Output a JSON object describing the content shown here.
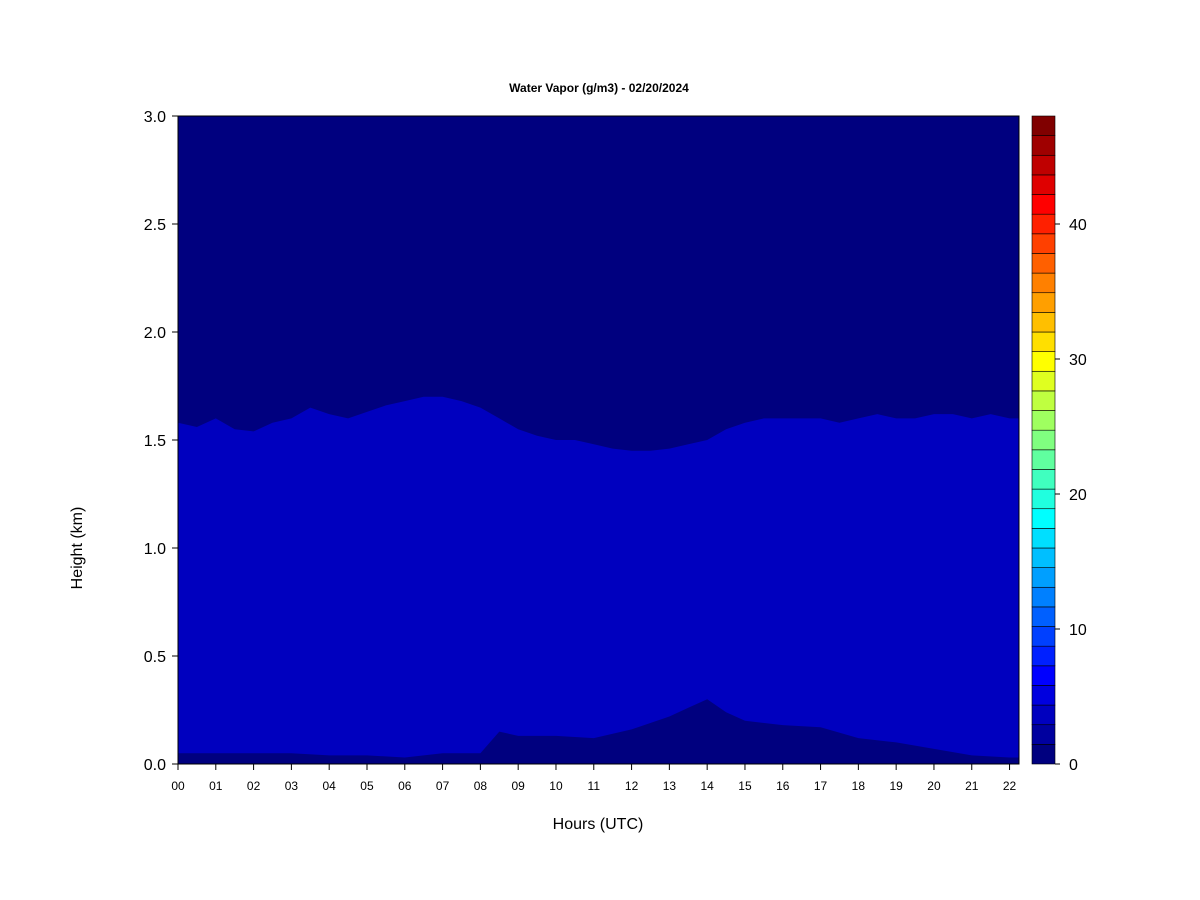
{
  "chart_data": {
    "type": "heatmap",
    "title": "Water Vapor (g/m3) - 02/20/2024",
    "xlabel": "Hours (UTC)",
    "ylabel": "Height (km)",
    "xlim": [
      0,
      22.25
    ],
    "ylim": [
      0,
      3.0
    ],
    "x_ticks": [
      0,
      1,
      2,
      3,
      4,
      5,
      6,
      7,
      8,
      9,
      10,
      11,
      12,
      13,
      14,
      15,
      16,
      17,
      18,
      19,
      20,
      21,
      22
    ],
    "x_tick_labels": [
      "00",
      "01",
      "02",
      "03",
      "04",
      "05",
      "06",
      "07",
      "08",
      "09",
      "10",
      "11",
      "12",
      "13",
      "14",
      "15",
      "16",
      "17",
      "18",
      "19",
      "20",
      "21",
      "22"
    ],
    "y_ticks": [
      0.0,
      0.5,
      1.0,
      1.5,
      2.0,
      2.5,
      3.0
    ],
    "y_tick_labels": [
      "0.0",
      "0.5",
      "1.0",
      "1.5",
      "2.0",
      "2.5",
      "3.0"
    ],
    "colorbar": {
      "range": [
        0,
        48
      ],
      "step": 2,
      "tick_values": [
        0,
        10,
        20,
        30,
        40
      ],
      "tick_labels": [
        "0",
        "10",
        "20",
        "30",
        "40"
      ],
      "colors": [
        "#00007f",
        "#00009f",
        "#0000bf",
        "#0000df",
        "#0000ff",
        "#0020ff",
        "#0040ff",
        "#0060ff",
        "#0080ff",
        "#009fff",
        "#00bfff",
        "#00dfff",
        "#00ffff",
        "#20ffdf",
        "#40ffbf",
        "#60ff9f",
        "#80ff80",
        "#9fff60",
        "#bfff40",
        "#dfff20",
        "#ffff00",
        "#ffdf00",
        "#ffbf00",
        "#ff9f00",
        "#ff8000",
        "#ff6000",
        "#ff4000",
        "#ff2000",
        "#ff0000",
        "#df0000",
        "#bf0000",
        "#9f0000",
        "#800000"
      ]
    },
    "layers": [
      {
        "value_range": [
          0,
          2
        ],
        "color": "#00007f",
        "description_region": "above moist layer",
        "boundary_km": [
          [
            0,
            1.58
          ],
          [
            0.5,
            1.56
          ],
          [
            1,
            1.6
          ],
          [
            1.5,
            1.55
          ],
          [
            2,
            1.54
          ],
          [
            2.5,
            1.58
          ],
          [
            3,
            1.6
          ],
          [
            3.5,
            1.65
          ],
          [
            4,
            1.62
          ],
          [
            4.5,
            1.6
          ],
          [
            5,
            1.63
          ],
          [
            5.5,
            1.66
          ],
          [
            6,
            1.68
          ],
          [
            6.5,
            1.7
          ],
          [
            7,
            1.7
          ],
          [
            7.5,
            1.68
          ],
          [
            8,
            1.65
          ],
          [
            8.5,
            1.6
          ],
          [
            9,
            1.55
          ],
          [
            9.5,
            1.52
          ],
          [
            10,
            1.5
          ],
          [
            10.5,
            1.5
          ],
          [
            11,
            1.48
          ],
          [
            11.5,
            1.46
          ],
          [
            12,
            1.45
          ],
          [
            12.5,
            1.45
          ],
          [
            13,
            1.46
          ],
          [
            13.5,
            1.48
          ],
          [
            14,
            1.5
          ],
          [
            14.5,
            1.55
          ],
          [
            15,
            1.58
          ],
          [
            15.5,
            1.6
          ],
          [
            16,
            1.6
          ],
          [
            16.5,
            1.6
          ],
          [
            17,
            1.6
          ],
          [
            17.5,
            1.58
          ],
          [
            18,
            1.6
          ],
          [
            18.5,
            1.62
          ],
          [
            19,
            1.6
          ],
          [
            19.5,
            1.6
          ],
          [
            20,
            1.62
          ],
          [
            20.5,
            1.62
          ],
          [
            21,
            1.6
          ],
          [
            21.5,
            1.62
          ],
          [
            22,
            1.6
          ],
          [
            22.25,
            1.6
          ]
        ]
      },
      {
        "value_range": [
          2,
          4
        ],
        "color": "#0000bf"
      },
      {
        "value_range": [
          0,
          2
        ],
        "color": "#00007f",
        "description_region": "near-surface layer",
        "boundary_km": [
          [
            0,
            0.05
          ],
          [
            1,
            0.05
          ],
          [
            2,
            0.05
          ],
          [
            3,
            0.05
          ],
          [
            4,
            0.04
          ],
          [
            5,
            0.04
          ],
          [
            6,
            0.03
          ],
          [
            7,
            0.05
          ],
          [
            8,
            0.05
          ],
          [
            8.5,
            0.15
          ],
          [
            9,
            0.13
          ],
          [
            10,
            0.13
          ],
          [
            11,
            0.12
          ],
          [
            12,
            0.16
          ],
          [
            13,
            0.22
          ],
          [
            13.5,
            0.26
          ],
          [
            14,
            0.3
          ],
          [
            14.5,
            0.24
          ],
          [
            15,
            0.2
          ],
          [
            16,
            0.18
          ],
          [
            17,
            0.17
          ],
          [
            18,
            0.12
          ],
          [
            19,
            0.1
          ],
          [
            20,
            0.07
          ],
          [
            21,
            0.04
          ],
          [
            22,
            0.03
          ],
          [
            22.25,
            0.03
          ]
        ]
      }
    ]
  }
}
